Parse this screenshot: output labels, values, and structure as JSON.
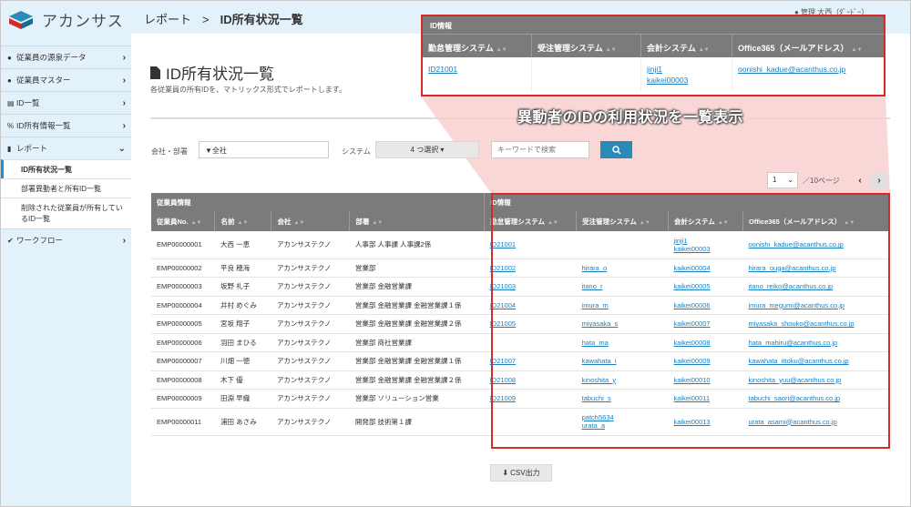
{
  "app": {
    "logo_text": "アカンサス"
  },
  "breadcrumb": {
    "parent": "レポート",
    "sep": ">",
    "current": "ID所有状況一覧"
  },
  "header_user": "● 管理 大西（ﾀﾞｰﾄﾞｰ）",
  "sidebar": {
    "items": [
      {
        "label": "従業員の源泉データ",
        "icon": "user-icon"
      },
      {
        "label": "従業員マスター",
        "icon": "users-icon"
      },
      {
        "label": "ID一覧",
        "icon": "id-card-icon"
      },
      {
        "label": "ID所有情報一覧",
        "icon": "link-icon"
      },
      {
        "label": "レポート",
        "icon": "file-icon"
      }
    ],
    "sub_items": [
      "ID所有状況一覧",
      "部署異動者と所有ID一覧",
      "削除された従業員が所有しているID一覧"
    ],
    "last_item": {
      "label": "ワークフロー",
      "icon": "check-icon"
    }
  },
  "page": {
    "title": "ID所有状況一覧",
    "subtitle": "各従業員の所有IDを、マトリックス形式でレポートします。"
  },
  "filters": {
    "dept_label": "会社・部署",
    "dept_value": "▼全社",
    "system_label": "システム",
    "system_value": "4 つ選択 ▾",
    "keyword_placeholder": "キーワードで検索"
  },
  "pager": {
    "page": "1",
    "total": "／10ページ"
  },
  "zoom": {
    "group": "ID情報",
    "headers": [
      "勤怠管理システム",
      "受注管理システム",
      "会計システム",
      "Office365（メールアドレス）"
    ],
    "row": [
      "ID21001",
      "",
      "jinji1\nkaikei00003",
      "oonishi_kadue@acanthus.co.jp"
    ]
  },
  "callout": "異動者のIDの利用状況を一覧表示",
  "table": {
    "group_left": "従業員情報",
    "group_right": "ID情報",
    "headers": [
      "従業員No.",
      "名前",
      "会社",
      "部署",
      "勤怠管理システム",
      "受注管理システム",
      "会計システム",
      "Office365（メールアドレス）"
    ],
    "rows": [
      [
        "EMP00000001",
        "大西 一恵",
        "アカンサステクノ",
        "人事部 人事課 人事課2係",
        "ID21001",
        "",
        "jinji1\nkaikei00003",
        "oonishi_kadue@acanthus.co.jp"
      ],
      [
        "EMP00000002",
        "平良 穂海",
        "アカンサステクノ",
        "営業部",
        "ID21002",
        "hirara_o",
        "kaikei00004",
        "hirara_ouga@acanthus.co.jp"
      ],
      [
        "EMP00000003",
        "坂野 礼子",
        "アカンサステクノ",
        "営業部 金融営業課",
        "ID21003",
        "itano_r",
        "kaikei00005",
        "itano_reiko@acanthus.co.jp"
      ],
      [
        "EMP00000004",
        "井村 めぐみ",
        "アカンサステクノ",
        "営業部 金融営業課 金融営業課１係",
        "ID21004",
        "imura_m",
        "kaikei00006",
        "imura_megumi@acanthus.co.jp"
      ],
      [
        "EMP00000005",
        "宮坂 翔子",
        "アカンサステクノ",
        "営業部 金融営業課 金融営業課２係",
        "ID21005",
        "miyasaka_s",
        "kaikei00007",
        "miyasaka_shouko@acanthus.co.jp"
      ],
      [
        "EMP00000006",
        "羽田 まひる",
        "アカンサステクノ",
        "営業部 商社営業課",
        "",
        "hata_ma",
        "kaikei00008",
        "hata_mahiru@acanthus.co.jp"
      ],
      [
        "EMP00000007",
        "川畑 一徳",
        "アカンサステクノ",
        "営業部 金融営業課 金融営業課１係",
        "ID21007",
        "kawahata_i",
        "kaikei00009",
        "kawahata_ittoku@acanthus.co.jp"
      ],
      [
        "EMP00000008",
        "木下 優",
        "アカンサステクノ",
        "営業部 金融営業課 金融営業課２係",
        "ID21008",
        "kinoshita_y",
        "kaikei00010",
        "kinoshita_yuu@acanthus.co.jp"
      ],
      [
        "EMP00000009",
        "田淵 早織",
        "アカンサステクノ",
        "営業部 ソリューション営業",
        "ID21009",
        "tabuchi_s",
        "kaikei00011",
        "tabuchi_saori@acanthus.co.jp"
      ],
      [
        "EMP00000011",
        "浦田 あさみ",
        "アカンサステクノ",
        "開発部 技術第１課",
        "",
        "patch5634\nurata_a",
        "kaikei00013",
        "urata_asami@acanthus.co.jp"
      ]
    ]
  },
  "csv_label": "CSV出力",
  "colors": {
    "sidebar": "#e3f2fa",
    "accent": "#2a8ab8",
    "header_gray": "#7b7b7b",
    "highlight": "#d42a2a",
    "link": "#1a7fc1"
  }
}
